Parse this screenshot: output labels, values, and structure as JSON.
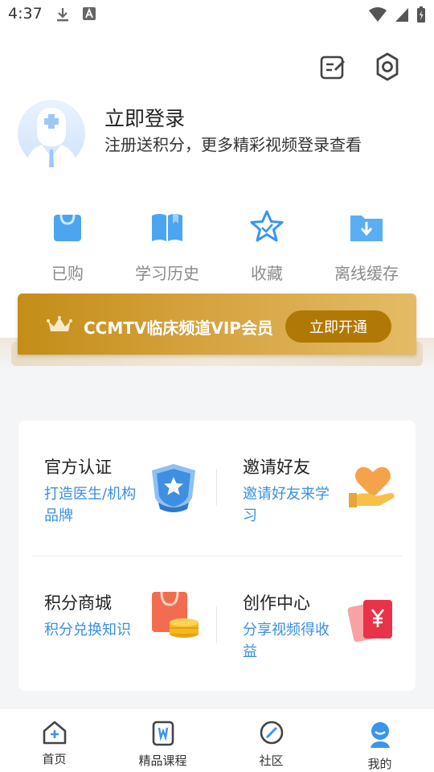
{
  "status_bar": {
    "time": "4:37"
  },
  "profile": {
    "login_title": "立即登录",
    "login_subtitle": "注册送积分，更多精彩视频登录查看"
  },
  "quick_menu": [
    {
      "label": "已购",
      "icon": "shopping-bag-icon"
    },
    {
      "label": "学习历史",
      "icon": "book-icon"
    },
    {
      "label": "收藏",
      "icon": "star-icon"
    },
    {
      "label": "离线缓存",
      "icon": "download-folder-icon"
    }
  ],
  "vip": {
    "text": "CCMTV临床频道VIP会员",
    "button": "立即开通"
  },
  "features": [
    {
      "title": "官方认证",
      "desc": "打造医生/机构品牌",
      "icon": "certified-shield-icon"
    },
    {
      "title": "邀请好友",
      "desc": "邀请好友来学习",
      "icon": "heart-hand-icon"
    },
    {
      "title": "积分商城",
      "desc": "积分兑换知识",
      "icon": "shopping-coins-icon"
    },
    {
      "title": "创作中心",
      "desc": "分享视频得收益",
      "icon": "red-envelope-icon"
    }
  ],
  "bottom_nav": [
    {
      "label": "首页",
      "icon": "home-icon"
    },
    {
      "label": "精品课程",
      "icon": "course-icon"
    },
    {
      "label": "社区",
      "icon": "compass-icon"
    },
    {
      "label": "我的",
      "icon": "user-icon",
      "active": true
    }
  ],
  "colors": {
    "accent_blue": "#3a8ee6",
    "vip_gold": "#c38d17",
    "vip_button": "#b07906"
  }
}
